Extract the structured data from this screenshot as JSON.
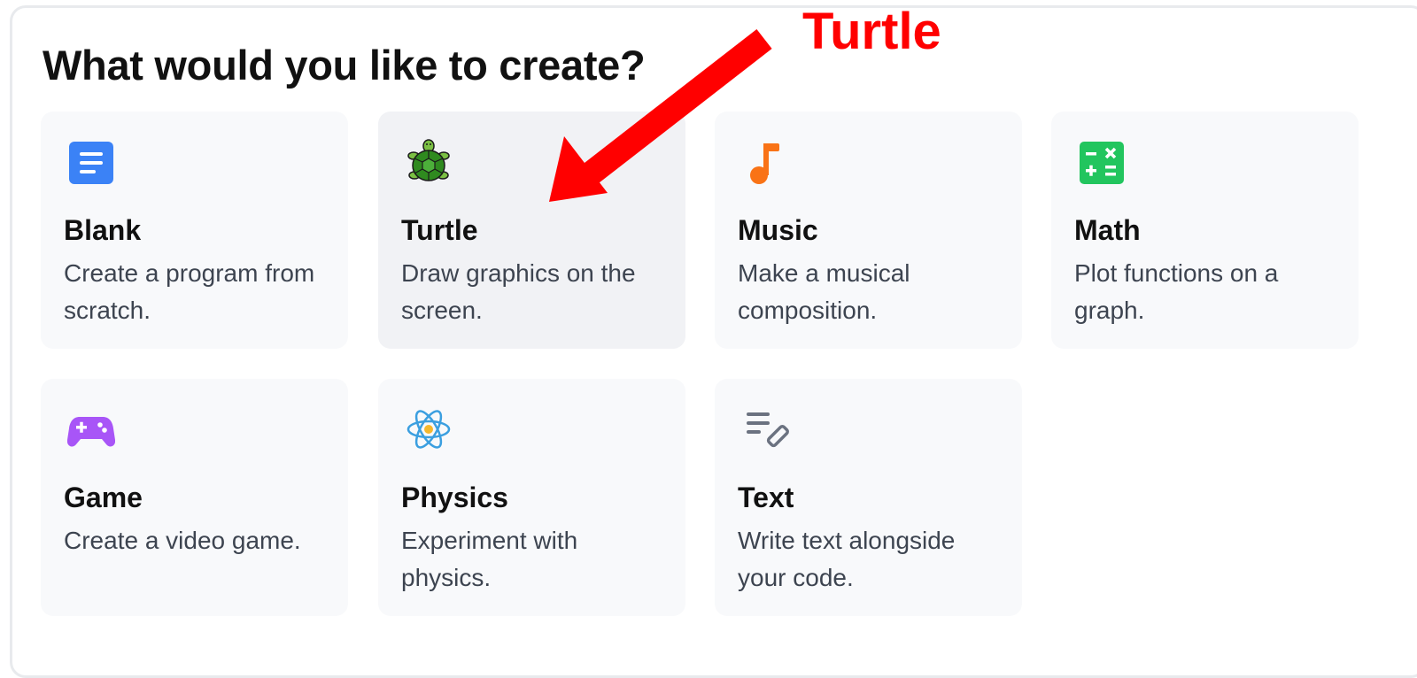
{
  "page": {
    "title": "What would you like to create?"
  },
  "annotation": {
    "label": "Turtle",
    "color": "#ff0000"
  },
  "cards": [
    {
      "title": "Blank",
      "description": "Create a program from scratch.",
      "icon": "document-icon",
      "color": "#3b82f6"
    },
    {
      "title": "Turtle",
      "description": "Draw graphics on the screen.",
      "icon": "turtle-icon",
      "color": "#2f9e2f"
    },
    {
      "title": "Music",
      "description": "Make a musical composition.",
      "icon": "music-note-icon",
      "color": "#f97316"
    },
    {
      "title": "Math",
      "description": "Plot functions on a graph.",
      "icon": "calculator-icon",
      "color": "#22c55e"
    },
    {
      "title": "Game",
      "description": "Create a video game.",
      "icon": "gamepad-icon",
      "color": "#a855f7"
    },
    {
      "title": "Physics",
      "description": "Experiment with physics.",
      "icon": "atom-icon",
      "color": "#3b9fe0"
    },
    {
      "title": "Text",
      "description": "Write text alongside your code.",
      "icon": "text-edit-icon",
      "color": "#6b7280"
    }
  ]
}
